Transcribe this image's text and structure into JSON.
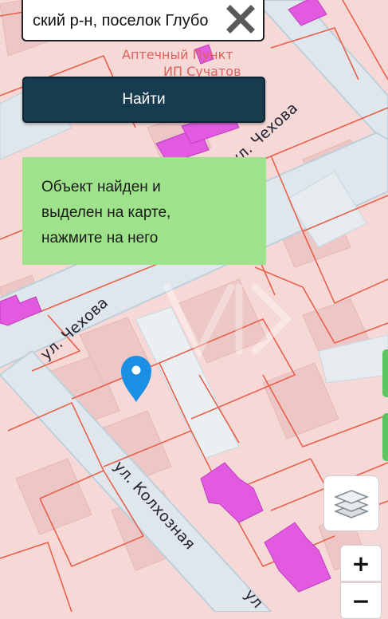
{
  "search": {
    "value": "ский р-н, поселок Глубо"
  },
  "find_button": {
    "label": "Найти"
  },
  "notice": {
    "lines": [
      "Объект найден и",
      "выделен на карте,",
      "нажмите на него"
    ]
  },
  "map": {
    "poi_name": "Аптечный Пункт",
    "poi_owner": "ИП Сучатов",
    "streets": {
      "chekhova": "ул. Чехова",
      "kolkhoznaya": "ул. Колхозная",
      "partial": "ул"
    }
  },
  "zoom": {
    "in_label": "+",
    "out_label": "−"
  },
  "colors": {
    "parcel_fill": "#f6d9d7",
    "parcel_border": "#e8604c",
    "road": "#dfe7ec",
    "road_edge": "#bcd0dc",
    "building": "#e9c2c0",
    "highlight_building": "#e15ae0",
    "pin": "#1a8fe3",
    "notice_bg": "#9ee38b",
    "button_bg": "#173c50"
  },
  "icons": {
    "clear": "close-icon",
    "pin": "location-pin-icon",
    "layers": "layers-icon"
  }
}
